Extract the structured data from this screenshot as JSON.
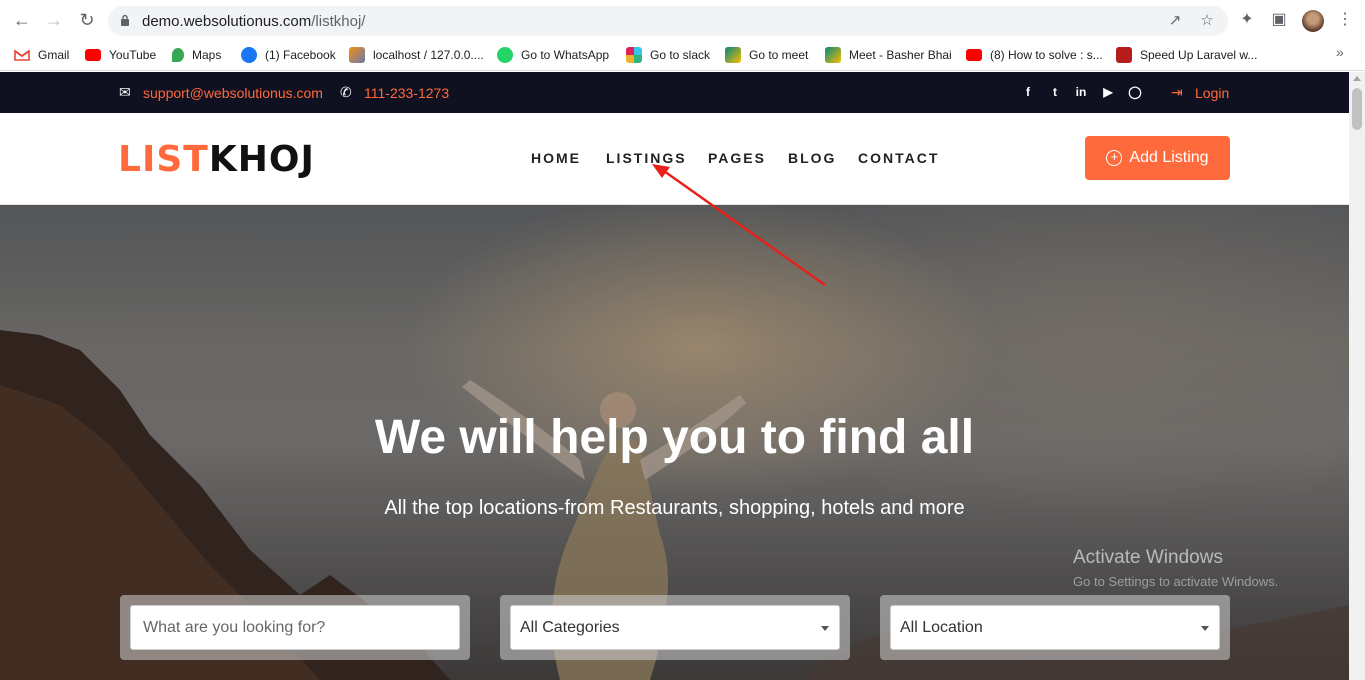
{
  "browser": {
    "url_host": "demo.websolutionus.com",
    "url_path": "/listkhoj/",
    "bookmarks": [
      {
        "label": "Gmail",
        "icon": "gmail-icon",
        "color": "#ea4335"
      },
      {
        "label": "YouTube",
        "icon": "youtube-icon",
        "color": "#ff0000"
      },
      {
        "label": "Maps",
        "icon": "maps-icon",
        "color": "#34a853"
      },
      {
        "label": "(1) Facebook",
        "icon": "facebook-icon",
        "color": "#1877f2"
      },
      {
        "label": "localhost / 127.0.0....",
        "icon": "phpmyadmin-icon",
        "color": "#f29111"
      },
      {
        "label": "Go to WhatsApp",
        "icon": "whatsapp-icon",
        "color": "#25d366"
      },
      {
        "label": "Go to slack",
        "icon": "slack-icon",
        "color": "#e01e5a"
      },
      {
        "label": "Go to meet",
        "icon": "meet-icon",
        "color": "#00897b"
      },
      {
        "label": "Meet - Basher Bhai",
        "icon": "meet-icon",
        "color": "#00897b"
      },
      {
        "label": "(8) How to solve : s...",
        "icon": "youtube-icon",
        "color": "#ff0000"
      },
      {
        "label": "Speed Up Laravel w...",
        "icon": "laravel-icon",
        "color": "#b71c1c"
      }
    ]
  },
  "topbar": {
    "email": "support@websolutionus.com",
    "phone": "111-233-1273",
    "login": "Login",
    "socials": [
      "facebook-icon",
      "twitter-icon",
      "linkedin-icon",
      "youtube-icon",
      "instagram-icon"
    ]
  },
  "header": {
    "logo_a": "LIST",
    "logo_b": "KHOJ",
    "menu": [
      "HOME",
      "LISTINGS",
      "PAGES",
      "BLOG",
      "CONTACT"
    ],
    "add_listing": "Add Listing"
  },
  "hero": {
    "title": "We will help you to find all",
    "subtitle": "All the top locations-from Restaurants, shopping, hotels and more",
    "search_placeholder": "What are you looking for?",
    "category_value": "All Categories",
    "location_value": "All Location"
  },
  "watermark": {
    "line1": "Activate Windows",
    "line2": "Go to Settings to activate Windows."
  },
  "colors": {
    "accent": "#ff6a3c",
    "topbar_bg": "#0f1020",
    "arrow": "#e8201a"
  }
}
